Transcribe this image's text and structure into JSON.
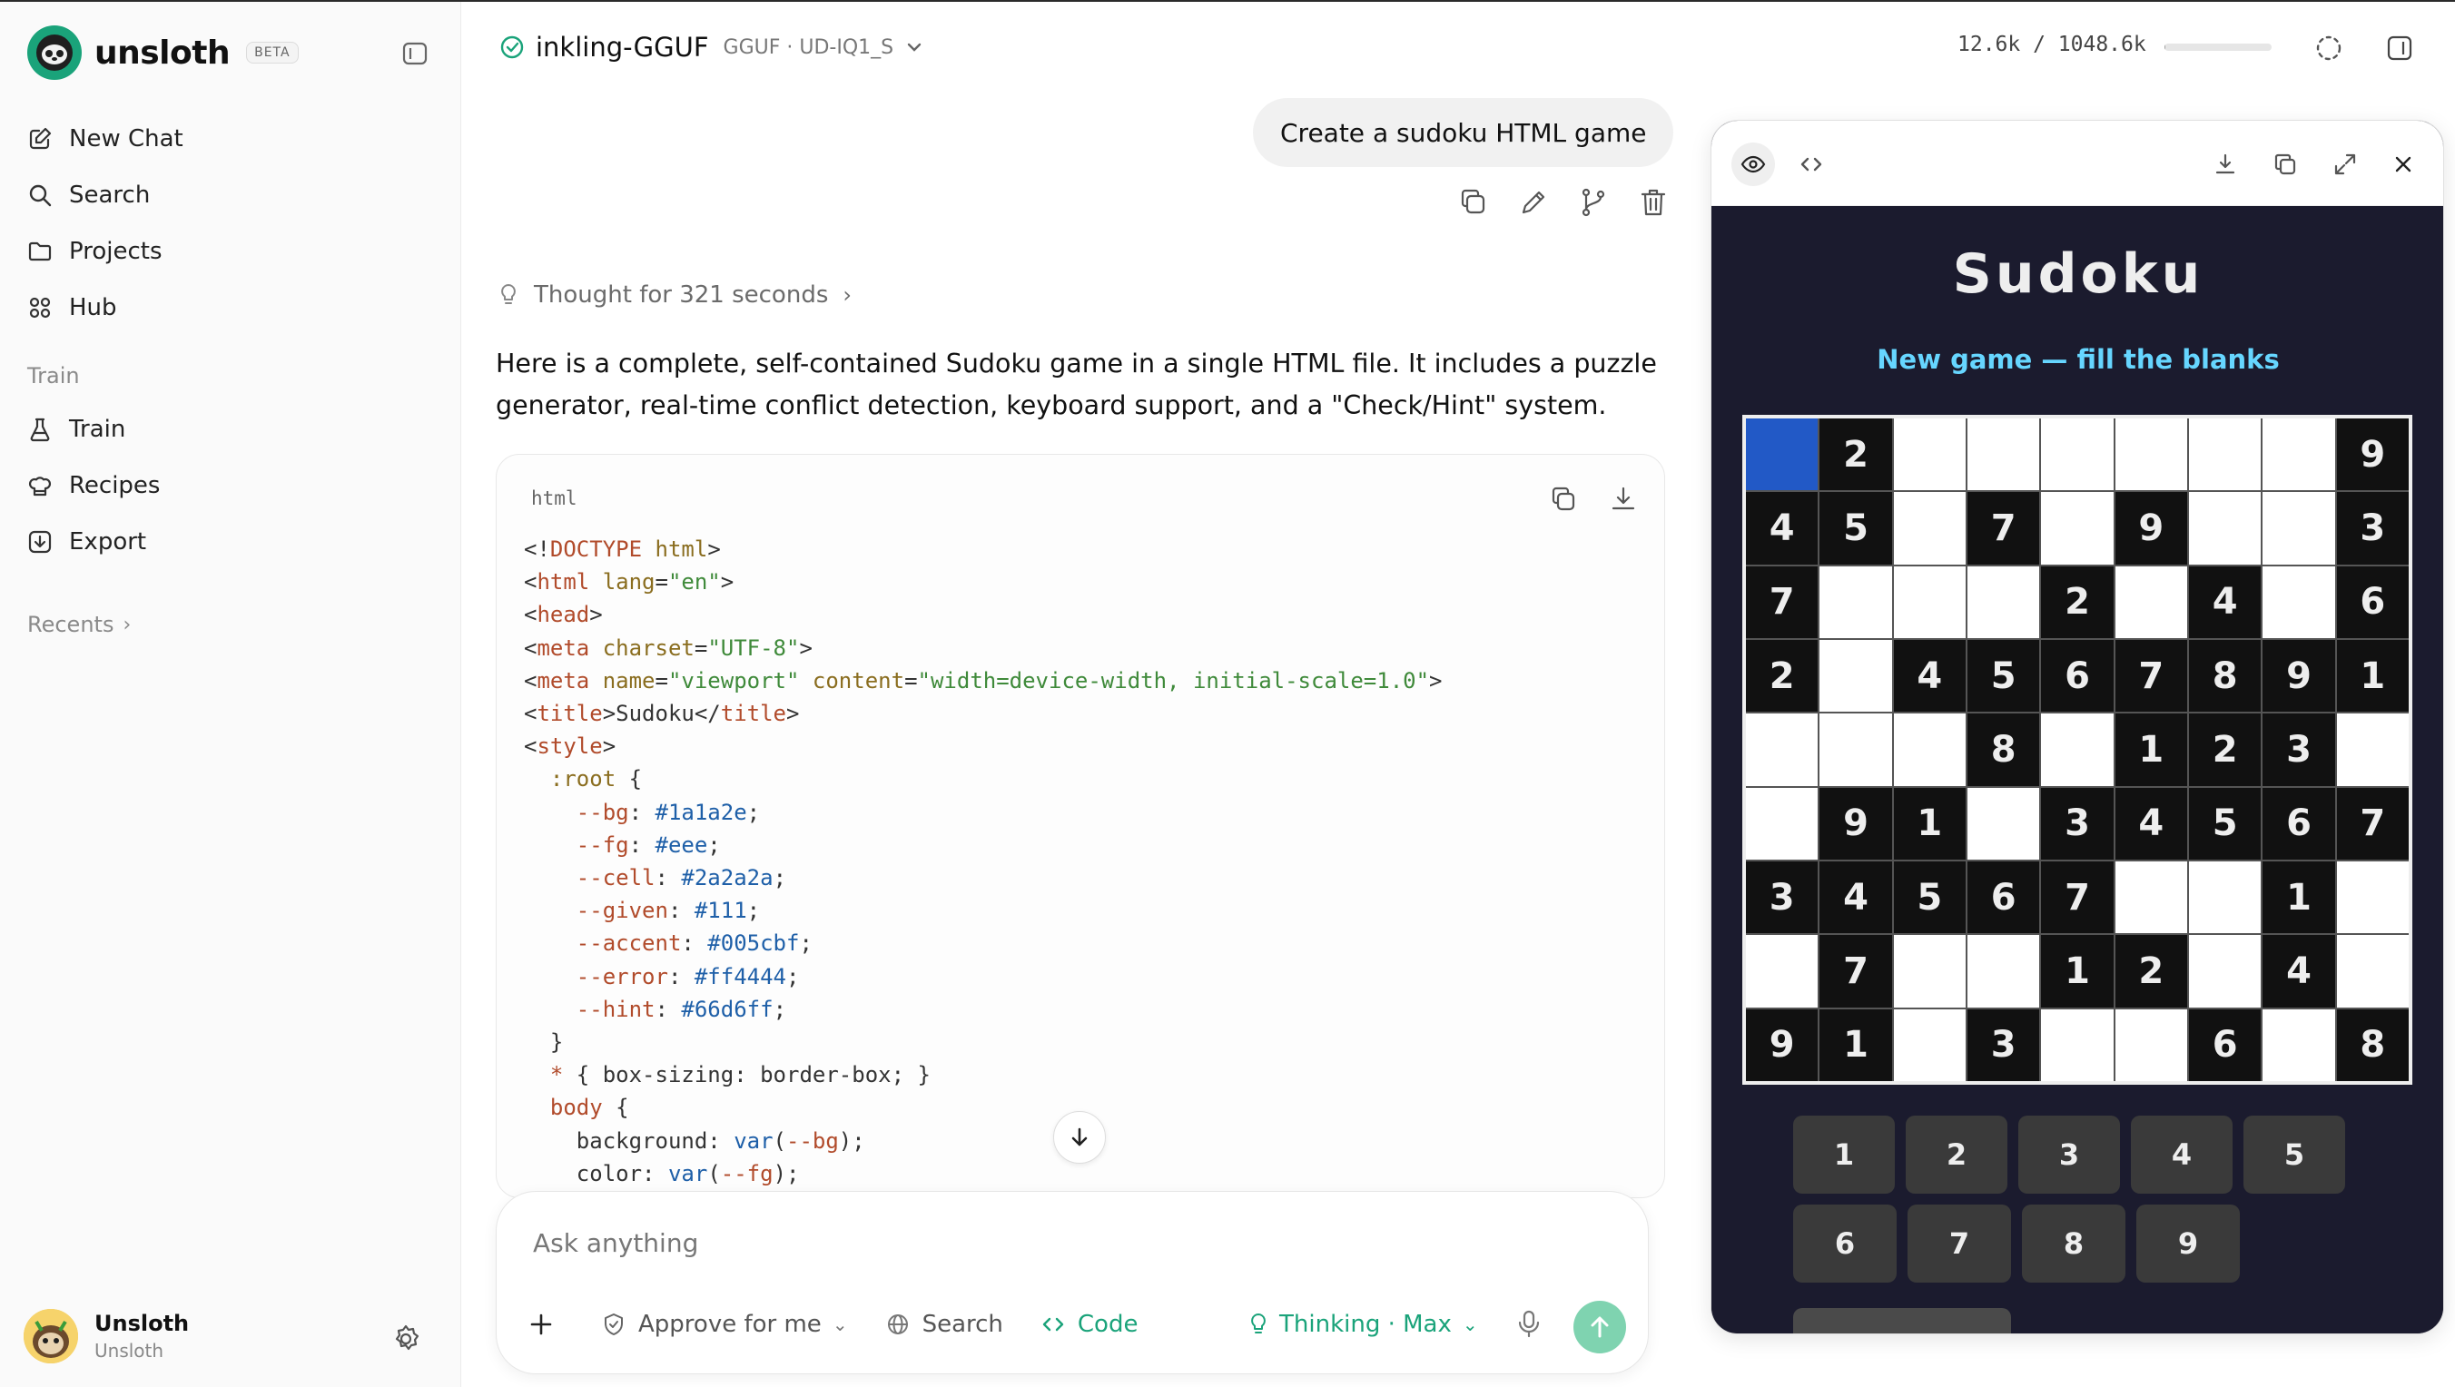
{
  "app": {
    "name": "unsloth",
    "badge": "BETA"
  },
  "sidebar": {
    "items": [
      {
        "label": "New Chat",
        "icon": "edit-icon"
      },
      {
        "label": "Search",
        "icon": "search-icon"
      },
      {
        "label": "Projects",
        "icon": "folder-icon"
      },
      {
        "label": "Hub",
        "icon": "grid-icon"
      }
    ],
    "train_section": "Train",
    "train_items": [
      {
        "label": "Train",
        "icon": "flask-icon"
      },
      {
        "label": "Recipes",
        "icon": "chef-hat-icon"
      },
      {
        "label": "Export",
        "icon": "download-box-icon"
      }
    ],
    "recents": "Recents",
    "user": {
      "name": "Unsloth",
      "sub": "Unsloth"
    }
  },
  "topbar": {
    "model_name": "inkling-GGUF",
    "model_meta": "GGUF · UD-IQ1_S",
    "tokens": "12.6k / 1048.6k",
    "token_fraction": 0.012
  },
  "chat": {
    "user_message": "Create a sudoku HTML game",
    "thought": "Thought for 321 seconds",
    "answer": "Here is a complete, self-contained Sudoku game in a single HTML file. It includes a puzzle generator, real-time conflict detection, keyboard support, and a \"Check/Hint\" system.",
    "code_lang": "html"
  },
  "composer": {
    "placeholder": "Ask anything",
    "approve": "Approve for me",
    "search": "Search",
    "code": "Code",
    "thinking": "Thinking · Max"
  },
  "preview": {
    "title": "Sudoku",
    "status": "New game — fill the blanks",
    "board": [
      "",
      "2",
      "",
      "",
      "",
      "",
      "",
      "",
      "9",
      "4",
      "5",
      "",
      "7",
      "",
      "9",
      "",
      "",
      "3",
      "7",
      "",
      "",
      "",
      "2",
      "",
      "4",
      "",
      "6",
      "2",
      "",
      "4",
      "5",
      "6",
      "7",
      "8",
      "9",
      "1",
      "",
      "",
      "",
      "8",
      "",
      "1",
      "2",
      "3",
      "",
      "",
      "9",
      "1",
      "",
      "3",
      "4",
      "5",
      "6",
      "7",
      "3",
      "4",
      "5",
      "6",
      "7",
      "",
      "",
      "1",
      "",
      "",
      "7",
      "",
      "",
      "1",
      "2",
      "",
      "4",
      "",
      "9",
      "1",
      "",
      "3",
      "",
      "",
      "6",
      "",
      "8"
    ],
    "selected_cell": 0,
    "keypad": [
      "1",
      "2",
      "3",
      "4",
      "5",
      "6",
      "7",
      "8",
      "9"
    ]
  }
}
